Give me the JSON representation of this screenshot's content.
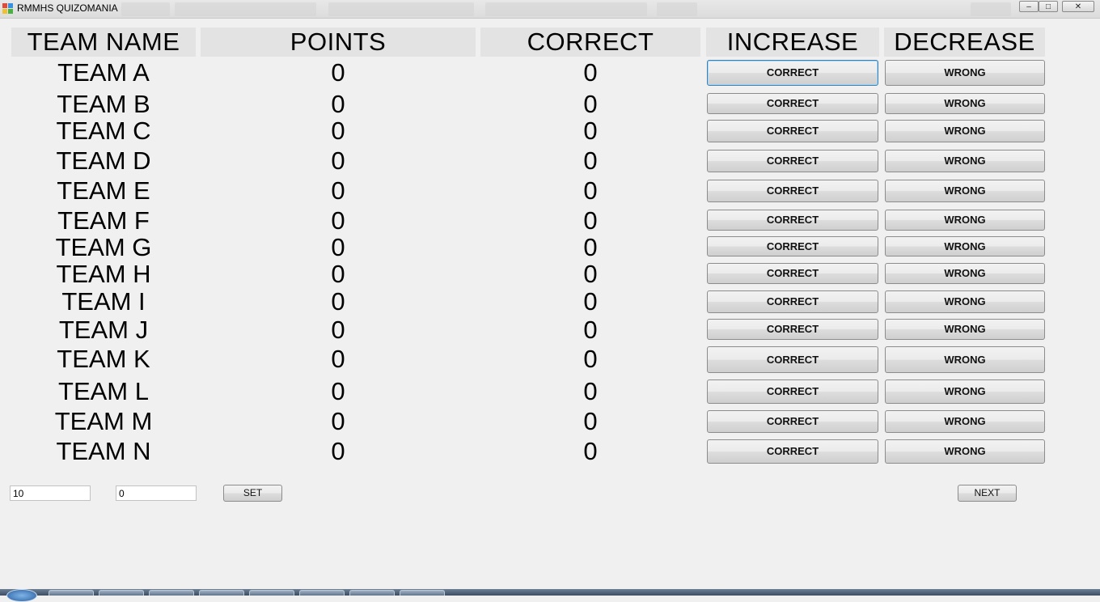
{
  "window": {
    "title": "RMMHS QUIZOMANIA",
    "minimize": "–",
    "maximize": "□",
    "close": "✕"
  },
  "headers": {
    "team_name": "TEAM NAME",
    "points": "POINTS",
    "correct": "CORRECT",
    "increase": "INCREASE",
    "decrease": "DECREASE"
  },
  "teams": [
    {
      "name": "TEAM A",
      "points": "0",
      "correct": "0",
      "inc_label": "CORRECT",
      "dec_label": "WRONG"
    },
    {
      "name": "TEAM B",
      "points": "0",
      "correct": "0",
      "inc_label": "CORRECT",
      "dec_label": "WRONG"
    },
    {
      "name": "TEAM C",
      "points": "0",
      "correct": "0",
      "inc_label": "CORRECT",
      "dec_label": "WRONG"
    },
    {
      "name": "TEAM D",
      "points": "0",
      "correct": "0",
      "inc_label": "CORRECT",
      "dec_label": "WRONG"
    },
    {
      "name": "TEAM E",
      "points": "0",
      "correct": "0",
      "inc_label": "CORRECT",
      "dec_label": "WRONG"
    },
    {
      "name": "TEAM F",
      "points": "0",
      "correct": "0",
      "inc_label": "CORRECT",
      "dec_label": "WRONG"
    },
    {
      "name": "TEAM G",
      "points": "0",
      "correct": "0",
      "inc_label": "CORRECT",
      "dec_label": "WRONG"
    },
    {
      "name": "TEAM H",
      "points": "0",
      "correct": "0",
      "inc_label": "CORRECT",
      "dec_label": "WRONG"
    },
    {
      "name": "TEAM I",
      "points": "0",
      "correct": "0",
      "inc_label": "CORRECT",
      "dec_label": "WRONG"
    },
    {
      "name": "TEAM J",
      "points": "0",
      "correct": "0",
      "inc_label": "CORRECT",
      "dec_label": "WRONG"
    },
    {
      "name": "TEAM K",
      "points": "0",
      "correct": "0",
      "inc_label": "CORRECT",
      "dec_label": "WRONG"
    },
    {
      "name": "TEAM L",
      "points": "0",
      "correct": "0",
      "inc_label": "CORRECT",
      "dec_label": "WRONG"
    },
    {
      "name": "TEAM M",
      "points": "0",
      "correct": "0",
      "inc_label": "CORRECT",
      "dec_label": "WRONG"
    },
    {
      "name": "TEAM N",
      "points": "0",
      "correct": "0",
      "inc_label": "CORRECT",
      "dec_label": "WRONG"
    }
  ],
  "controls": {
    "value1": "10",
    "value2": "0",
    "set_label": "SET",
    "next_label": "NEXT"
  },
  "colors": {
    "background": "#f0f0f0",
    "header_bg": "#e3e3e3",
    "focus_border": "#3c7fb1"
  }
}
